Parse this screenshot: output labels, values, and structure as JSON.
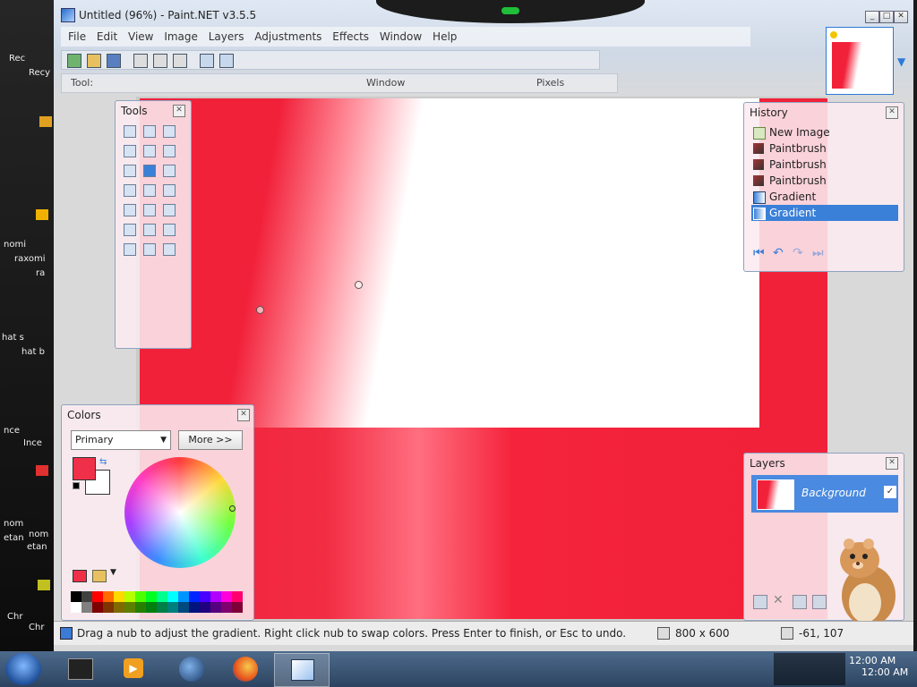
{
  "window": {
    "title": "Untitled (96%) - Paint.NET v3.5.5",
    "controls": {
      "minimize": "_",
      "maximize": "□",
      "close": "✕"
    }
  },
  "menu": {
    "items": [
      "File",
      "Edit",
      "View",
      "Image",
      "Layers",
      "Adjustments",
      "Effects",
      "Window",
      "Help"
    ]
  },
  "toolbar": {
    "row2_label": "Tool:",
    "window_label": "Window",
    "units_label": "Pixels"
  },
  "tools_panel": {
    "title": "Tools",
    "close": "✕"
  },
  "history_panel": {
    "title": "History",
    "close": "✕",
    "items": [
      {
        "label": "New Image",
        "icon": "new-image-icon"
      },
      {
        "label": "Paintbrush",
        "icon": "paintbrush-icon"
      },
      {
        "label": "Paintbrush",
        "icon": "paintbrush-icon"
      },
      {
        "label": "Paintbrush",
        "icon": "paintbrush-icon"
      },
      {
        "label": "Gradient",
        "icon": "gradient-icon"
      },
      {
        "label": "Gradient",
        "icon": "gradient-icon"
      }
    ],
    "selected_index": 5,
    "nav_icons": [
      "rewind-icon",
      "undo-icon",
      "redo-icon",
      "fast-forward-icon"
    ]
  },
  "colors_panel": {
    "title": "Colors",
    "close": "✕",
    "select_value": "Primary",
    "more_button": "More >>",
    "primary_color": "#f03049",
    "secondary_color": "#ffffff"
  },
  "layers_panel": {
    "title": "Layers",
    "close": "✕",
    "layer_name": "Background",
    "layer_visible": true
  },
  "status_bar": {
    "message": "Drag a nub to adjust the gradient. Right click nub to swap colors. Press Enter to finish, or Esc to undo.",
    "image_size": "800 x 600",
    "cursor_position": "-61, 107"
  },
  "taskbar": {
    "apps": [
      "terminal-icon",
      "media-player-icon",
      "globe-icon",
      "firefox-icon",
      "paint-net-icon"
    ],
    "clock_1": "12:00 AM",
    "clock_2": "12:00 AM"
  },
  "desktop_labels": [
    "Rec",
    "Recy",
    "nomi",
    "raxomi",
    "ra",
    "hat s",
    "hat b",
    "nce",
    "Ince",
    "nom",
    "etan",
    "nom",
    "etan",
    "Chr",
    "Chr"
  ],
  "colors": {
    "accent": "#3a80d9",
    "gradient_red": "#f1213a"
  }
}
